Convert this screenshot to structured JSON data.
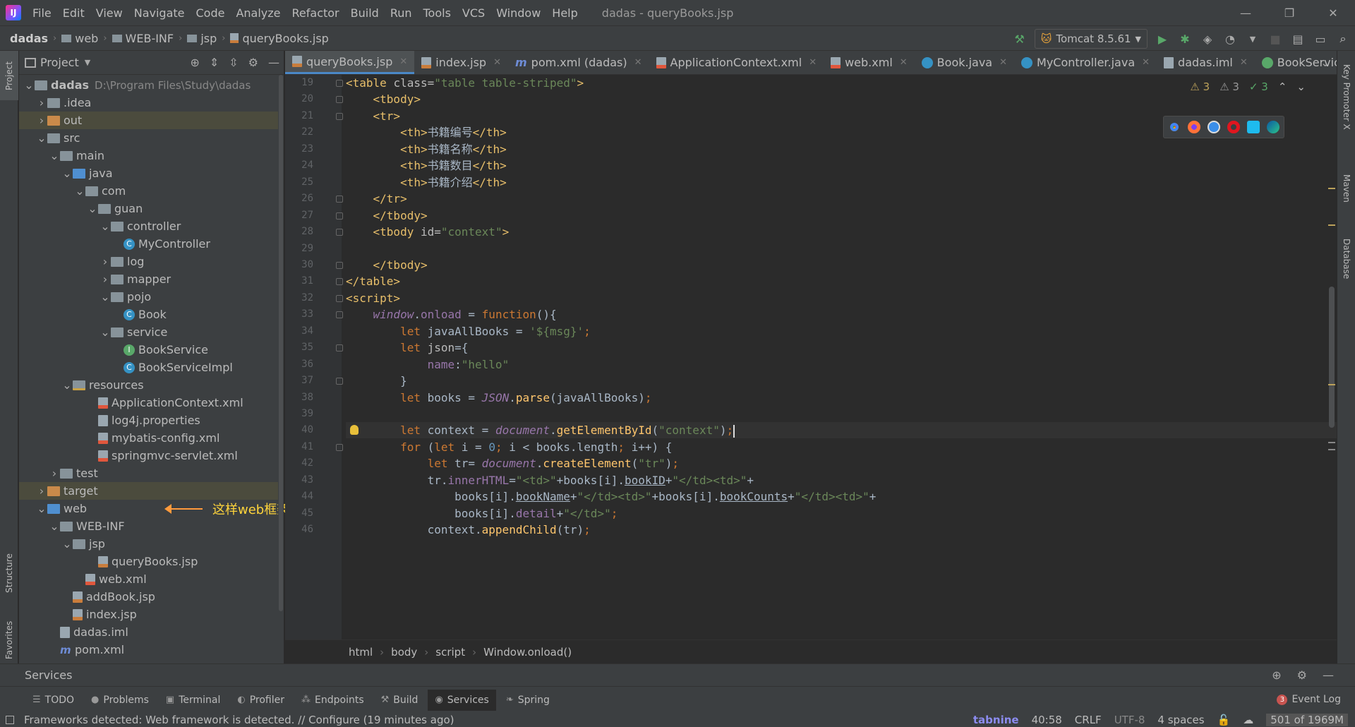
{
  "titlebar": {
    "app_logo": "IJ",
    "menu": [
      "File",
      "Edit",
      "View",
      "Navigate",
      "Code",
      "Analyze",
      "Refactor",
      "Build",
      "Run",
      "Tools",
      "VCS",
      "Window",
      "Help"
    ],
    "window_title": "dadas - queryBooks.jsp"
  },
  "navbar": {
    "breadcrumb": [
      "dadas",
      "web",
      "WEB-INF",
      "jsp",
      "queryBooks.jsp"
    ],
    "run_config": "Tomcat 8.5.61"
  },
  "left_strip": {
    "project": "Project",
    "structure": "Structure",
    "favorites": "Favorites"
  },
  "right_strip": {
    "key_promoter": "Key Promoter X",
    "maven": "Maven",
    "database": "Database"
  },
  "project_panel": {
    "title": "Project",
    "tree": [
      {
        "label": "dadas",
        "path": "D:\\Program Files\\Study\\dadas",
        "depth": 0,
        "arrow": "down",
        "icon": "folder"
      },
      {
        "label": ".idea",
        "depth": 1,
        "arrow": "right",
        "icon": "folder"
      },
      {
        "label": "out",
        "depth": 1,
        "arrow": "right",
        "icon": "folder-orange",
        "selected": true
      },
      {
        "label": "src",
        "depth": 1,
        "arrow": "down",
        "icon": "folder"
      },
      {
        "label": "main",
        "depth": 2,
        "arrow": "down",
        "icon": "folder"
      },
      {
        "label": "java",
        "depth": 3,
        "arrow": "down",
        "icon": "folder-blue"
      },
      {
        "label": "com",
        "depth": 4,
        "arrow": "down",
        "icon": "folder"
      },
      {
        "label": "guan",
        "depth": 5,
        "arrow": "down",
        "icon": "folder"
      },
      {
        "label": "controller",
        "depth": 6,
        "arrow": "down",
        "icon": "folder"
      },
      {
        "label": "MyController",
        "depth": 7,
        "arrow": "",
        "icon": "class"
      },
      {
        "label": "log",
        "depth": 6,
        "arrow": "right",
        "icon": "folder"
      },
      {
        "label": "mapper",
        "depth": 6,
        "arrow": "right",
        "icon": "folder"
      },
      {
        "label": "pojo",
        "depth": 6,
        "arrow": "down",
        "icon": "folder"
      },
      {
        "label": "Book",
        "depth": 7,
        "arrow": "",
        "icon": "class"
      },
      {
        "label": "service",
        "depth": 6,
        "arrow": "down",
        "icon": "folder"
      },
      {
        "label": "BookService",
        "depth": 7,
        "arrow": "",
        "icon": "interface"
      },
      {
        "label": "BookServiceImpl",
        "depth": 7,
        "arrow": "",
        "icon": "class"
      },
      {
        "label": "resources",
        "depth": 3,
        "arrow": "down",
        "icon": "folder-res"
      },
      {
        "label": "ApplicationContext.xml",
        "depth": 5,
        "arrow": "",
        "icon": "xml"
      },
      {
        "label": "log4j.properties",
        "depth": 5,
        "arrow": "",
        "icon": "file"
      },
      {
        "label": "mybatis-config.xml",
        "depth": 5,
        "arrow": "",
        "icon": "xml"
      },
      {
        "label": "springmvc-servlet.xml",
        "depth": 5,
        "arrow": "",
        "icon": "xml"
      },
      {
        "label": "test",
        "depth": 2,
        "arrow": "right",
        "icon": "folder"
      },
      {
        "label": "target",
        "depth": 1,
        "arrow": "right",
        "icon": "folder-orange",
        "selected": true
      },
      {
        "label": "web",
        "depth": 1,
        "arrow": "down",
        "icon": "folder-blue",
        "annotation": "这样web框架标志就出来了"
      },
      {
        "label": "WEB-INF",
        "depth": 2,
        "arrow": "down",
        "icon": "folder"
      },
      {
        "label": "jsp",
        "depth": 3,
        "arrow": "down",
        "icon": "folder"
      },
      {
        "label": "queryBooks.jsp",
        "depth": 5,
        "arrow": "",
        "icon": "jsp"
      },
      {
        "label": "web.xml",
        "depth": 4,
        "arrow": "",
        "icon": "xml"
      },
      {
        "label": "addBook.jsp",
        "depth": 3,
        "arrow": "",
        "icon": "jsp"
      },
      {
        "label": "index.jsp",
        "depth": 3,
        "arrow": "",
        "icon": "jsp"
      },
      {
        "label": "dadas.iml",
        "depth": 2,
        "arrow": "",
        "icon": "file"
      },
      {
        "label": "pom.xml",
        "depth": 2,
        "arrow": "",
        "icon": "maven"
      }
    ]
  },
  "editor": {
    "tabs": [
      {
        "label": "queryBooks.jsp",
        "icon": "jsp",
        "active": true
      },
      {
        "label": "index.jsp",
        "icon": "jsp"
      },
      {
        "label": "pom.xml (dadas)",
        "icon": "maven"
      },
      {
        "label": "ApplicationContext.xml",
        "icon": "xml"
      },
      {
        "label": "web.xml",
        "icon": "xml"
      },
      {
        "label": "Book.java",
        "icon": "class"
      },
      {
        "label": "MyController.java",
        "icon": "class"
      },
      {
        "label": "dadas.iml",
        "icon": "iml"
      },
      {
        "label": "BookService.jav",
        "icon": "interface"
      }
    ],
    "inspections": {
      "warnings": "3",
      "weak_warnings": "3",
      "ok": "3"
    },
    "breadcrumb": [
      "html",
      "body",
      "script",
      "Window.onload()"
    ],
    "current_line": 40,
    "lines": [
      {
        "n": "19",
        "html": "<span class='t'>&lt;table </span><span class='a'>class=</span><span class='s'>\"table table-striped\"</span><span class='t'>&gt;</span>"
      },
      {
        "n": "20",
        "html": "    <span class='t'>&lt;tbody&gt;</span>"
      },
      {
        "n": "21",
        "html": "    <span class='t'>&lt;tr&gt;</span>"
      },
      {
        "n": "22",
        "html": "        <span class='t'>&lt;th&gt;</span>书籍编号<span class='t'>&lt;/th&gt;</span>"
      },
      {
        "n": "23",
        "html": "        <span class='t'>&lt;th&gt;</span>书籍名称<span class='t'>&lt;/th&gt;</span>"
      },
      {
        "n": "24",
        "html": "        <span class='t'>&lt;th&gt;</span>书籍数目<span class='t'>&lt;/th&gt;</span>"
      },
      {
        "n": "25",
        "html": "        <span class='t'>&lt;th&gt;</span>书籍介绍<span class='t'>&lt;/th&gt;</span>"
      },
      {
        "n": "26",
        "html": "    <span class='t'>&lt;/tr&gt;</span>"
      },
      {
        "n": "27",
        "html": "    <span class='t'>&lt;/tbody&gt;</span>"
      },
      {
        "n": "28",
        "html": "    <span class='t'>&lt;tbody </span><span class='a'>id=</span><span class='s'>\"context\"</span><span class='t'>&gt;</span>"
      },
      {
        "n": "29",
        "html": ""
      },
      {
        "n": "30",
        "html": "    <span class='t'>&lt;/tbody&gt;</span>"
      },
      {
        "n": "31",
        "html": "<span class='t'>&lt;/table&gt;</span>"
      },
      {
        "n": "32",
        "html": "<span class='t'>&lt;script&gt;</span>"
      },
      {
        "n": "33",
        "html": "    <span class='g'>window</span>.<span class='p'>onload</span> = <span class='k'>function</span>(){"
      },
      {
        "n": "34",
        "html": "        <span class='k'>let</span> javaAllBooks = <span class='s'>'${msg}'</span><span class='k'>;</span>"
      },
      {
        "n": "35",
        "html": "        <span class='k'>let</span> <span class='a'>json</span>={"
      },
      {
        "n": "36",
        "html": "            <span class='p'>name</span>:<span class='s'>\"hello\"</span>"
      },
      {
        "n": "37",
        "html": "        }"
      },
      {
        "n": "38",
        "html": "        <span class='k'>let</span> books = <span class='g'>JSON</span>.<span class='f'>parse</span>(javaAllBooks)<span class='k'>;</span>"
      },
      {
        "n": "39",
        "html": ""
      },
      {
        "n": "40",
        "html": "        <span class='k'>let</span> context = <span class='g'>document</span>.<span class='f'>getElementById</span>(<span class='s'>\"context\"</span>)<span class='k'>;</span><span class='caret'></span>"
      },
      {
        "n": "41",
        "html": "        <span class='k'>for</span> (<span class='k'>let</span> i = <span class='n'>0</span><span class='k'>;</span> i &lt; books.length<span class='k'>;</span> i++) {"
      },
      {
        "n": "42",
        "html": "            <span class='k'>let</span> tr= <span class='g'>document</span>.<span class='f'>createElement</span>(<span class='s'>\"tr\"</span>)<span class='k'>;</span>"
      },
      {
        "n": "43",
        "html": "            tr.<span class='p'>innerHTML</span>=<span class='s'>\"&lt;td&gt;\"</span>+books[i].<span class='u'>bookID</span>+<span class='s'>\"&lt;/td&gt;&lt;td&gt;\"</span>+"
      },
      {
        "n": "44",
        "html": "                books[i].<span class='u'>bookName</span>+<span class='s'>\"&lt;/td&gt;&lt;td&gt;\"</span>+books[i].<span class='u'>bookCounts</span>+<span class='s'>\"&lt;/td&gt;&lt;td&gt;\"</span>+"
      },
      {
        "n": "45",
        "html": "                books[i].<span class='p'>detail</span>+<span class='s'>\"&lt;/td&gt;\"</span><span class='k'>;</span>"
      },
      {
        "n": "46",
        "html": "            context.<span class='f'>appendChild</span>(tr)<span class='k'>;</span>"
      }
    ]
  },
  "services_bar": {
    "title": "Services"
  },
  "tool_windows": [
    {
      "label": "TODO",
      "icon": "list-icon"
    },
    {
      "label": "Problems",
      "icon": "info-icon"
    },
    {
      "label": "Terminal",
      "icon": "terminal-icon"
    },
    {
      "label": "Profiler",
      "icon": "profiler-icon"
    },
    {
      "label": "Endpoints",
      "icon": "endpoints-icon"
    },
    {
      "label": "Build",
      "icon": "hammer-icon"
    },
    {
      "label": "Services",
      "icon": "services-icon",
      "active": true
    },
    {
      "label": "Spring",
      "icon": "leaf-icon"
    }
  ],
  "event_log": {
    "label": "Event Log",
    "count": "3"
  },
  "status": {
    "message": "Frameworks detected: Web framework is detected. // Configure (19 minutes ago)",
    "tabnine": "tabnine",
    "position": "40:58",
    "line_sep": "CRLF",
    "encoding": "UTF-8",
    "indent": "4 spaces",
    "memory": "501 of 1969M"
  },
  "colors": {
    "accent": "#4a88c7",
    "background": "#2b2b2b",
    "panel": "#3c3f41"
  }
}
